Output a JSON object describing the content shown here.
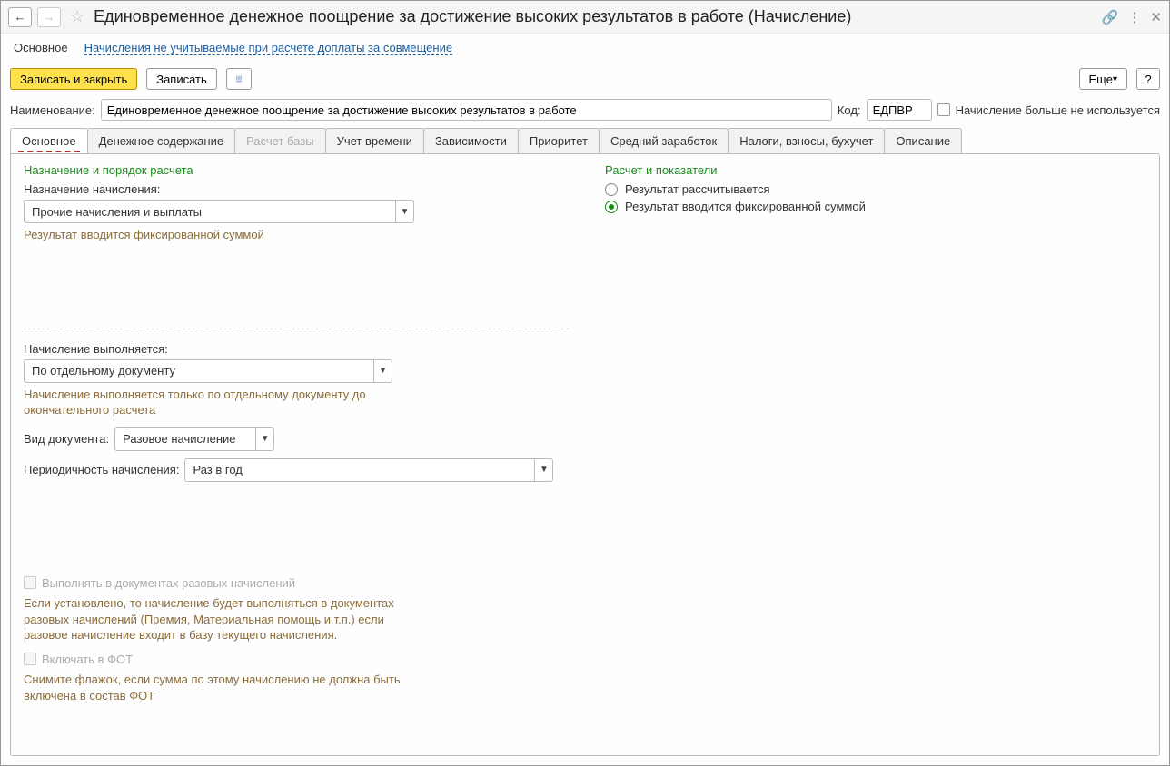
{
  "titlebar": {
    "title": "Единовременное денежное поощрение за достижение высоких результатов в работе (Начисление)"
  },
  "topnav": {
    "active": "Основное",
    "link": "Начисления не учитываемые при расчете доплаты за совмещение"
  },
  "toolbar": {
    "save_close": "Записать и закрыть",
    "save": "Записать",
    "more": "Еще",
    "help": "?"
  },
  "fields": {
    "name_label": "Наименование:",
    "name_value": "Единовременное денежное поощрение за достижение высоких результатов в работе",
    "code_label": "Код:",
    "code_value": "ЕДПВР",
    "not_used_label": "Начисление больше не используется"
  },
  "tabs": [
    "Основное",
    "Денежное содержание",
    "Расчет базы",
    "Учет времени",
    "Зависимости",
    "Приоритет",
    "Средний заработок",
    "Налоги, взносы, бухучет",
    "Описание"
  ],
  "left": {
    "section1_title": "Назначение и порядок расчета",
    "assign_label": "Назначение начисления:",
    "assign_value": "Прочие начисления и выплаты",
    "assign_note": "Результат вводится фиксированной суммой",
    "perform_label": "Начисление выполняется:",
    "perform_value": "По отдельному документу",
    "perform_note": "Начисление выполняется только по отдельному документу до окончательного расчета",
    "doc_type_label": "Вид документа:",
    "doc_type_value": "Разовое начисление",
    "period_label": "Периодичность начисления:",
    "period_value": "Раз в год",
    "chk1_label": "Выполнять в документах разовых начислений",
    "chk1_note": "Если установлено, то начисление будет выполняться в документах разовых начислений (Премия, Материальная помощь и т.п.) если разовое начисление входит в базу текущего начисления.",
    "chk2_label": "Включать в ФОТ",
    "chk2_note": "Снимите флажок, если сумма по этому начислению не должна быть включена в состав ФОТ"
  },
  "right": {
    "section_title": "Расчет и показатели",
    "radio1": "Результат рассчитывается",
    "radio2": "Результат вводится фиксированной суммой"
  }
}
